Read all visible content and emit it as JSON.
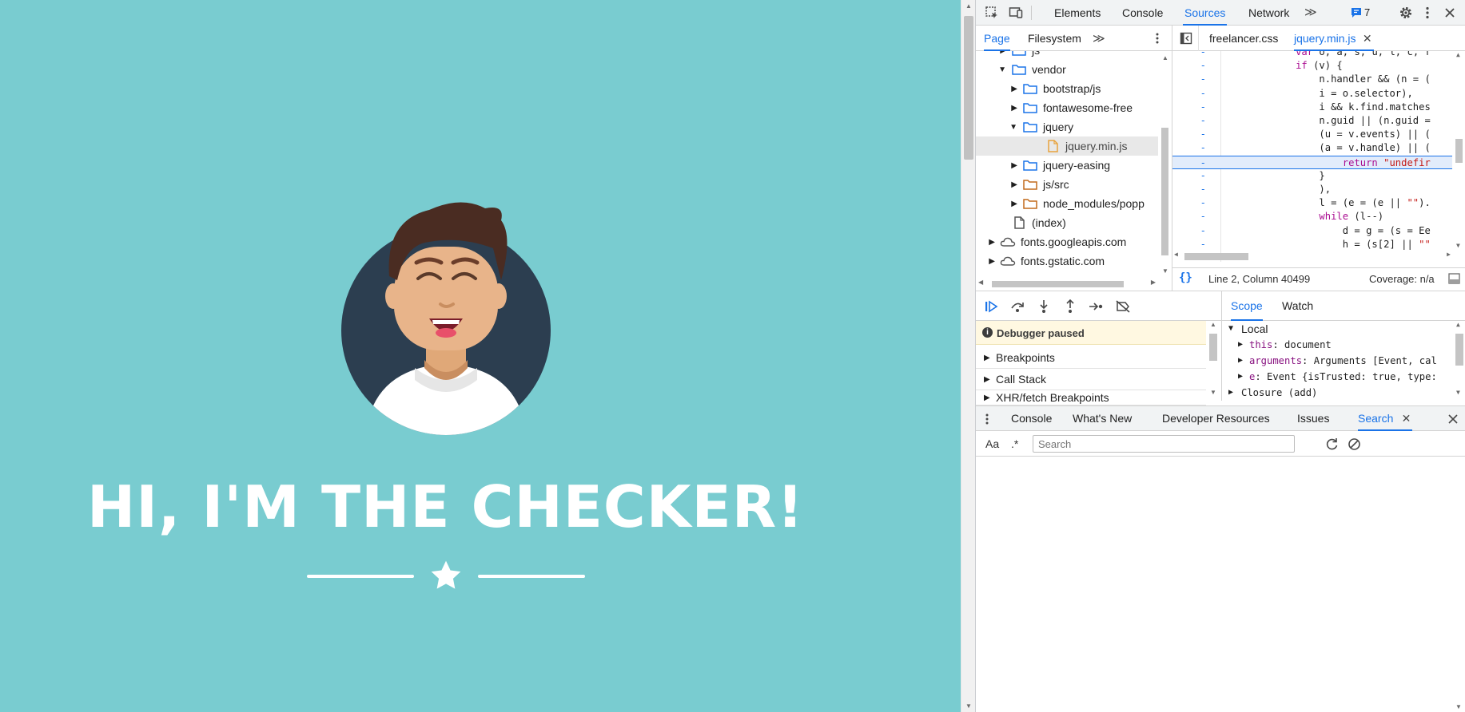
{
  "page": {
    "hero_title": "HI, I'M THE CHECKER!",
    "colors": {
      "background": "#79ccd0",
      "avatar_bg": "#2c3e50",
      "text": "#ffffff"
    }
  },
  "devtools": {
    "main_tabs": [
      "Elements",
      "Console",
      "Sources",
      "Network"
    ],
    "active_main_tab": "Sources",
    "issues_count": "7",
    "navigator_tabs": [
      "Page",
      "Filesystem"
    ],
    "tree": [
      {
        "label": "js",
        "kind": "folder",
        "color": "#1a73e8"
      },
      {
        "label": "vendor",
        "kind": "folder",
        "color": "#1a73e8"
      },
      {
        "label": "bootstrap/js",
        "kind": "folder",
        "color": "#1a73e8"
      },
      {
        "label": "fontawesome-free",
        "kind": "folder",
        "color": "#1a73e8"
      },
      {
        "label": "jquery",
        "kind": "folder",
        "color": "#1a73e8"
      },
      {
        "label": "jquery.min.js",
        "kind": "file",
        "color": "#e8a33d"
      },
      {
        "label": "jquery-easing",
        "kind": "folder",
        "color": "#1a73e8"
      },
      {
        "label": "js/src",
        "kind": "folder",
        "color": "#c26a1b"
      },
      {
        "label": "node_modules/popp",
        "kind": "folder",
        "color": "#c26a1b"
      },
      {
        "label": "(index)",
        "kind": "file",
        "color": "#555555"
      },
      {
        "label": "fonts.googleapis.com",
        "kind": "cloud",
        "color": "#555555"
      },
      {
        "label": "fonts.gstatic.com",
        "kind": "cloud",
        "color": "#555555"
      }
    ],
    "file_tabs": [
      "freelancer.css",
      "jquery.min.js"
    ],
    "active_file_tab": "jquery.min.js",
    "code_lines": [
      {
        "gutter": "-",
        "text": "            var o, a, s, u, l, c, f"
      },
      {
        "gutter": "-",
        "text": "            if (v) {"
      },
      {
        "gutter": "-",
        "text": "                n.handler && (n = ("
      },
      {
        "gutter": "-",
        "text": "                i = o.selector),"
      },
      {
        "gutter": "-",
        "text": "                i && k.find.matches"
      },
      {
        "gutter": "-",
        "text": "                n.guid || (n.guid ="
      },
      {
        "gutter": "-",
        "text": "                (u = v.events) || ("
      },
      {
        "gutter": "-",
        "text": "                (a = v.handle) || ("
      },
      {
        "gutter": "-",
        "text": "                    return \"undefir"
      },
      {
        "gutter": "-",
        "text": "                }"
      },
      {
        "gutter": "-",
        "text": "                ),"
      },
      {
        "gutter": "-",
        "text": "                l = (e = (e || \"\")."
      },
      {
        "gutter": "-",
        "text": "                while (l--)"
      },
      {
        "gutter": "-",
        "text": "                    d = g = (s = Ee"
      },
      {
        "gutter": "-",
        "text": "                    h = (s[2] || \"\""
      }
    ],
    "status": {
      "position": "Line 2, Column 40499",
      "coverage": "Coverage: n/a"
    },
    "debugger_paused": "Debugger paused",
    "sections": [
      "Breakpoints",
      "Call Stack",
      "XHR/fetch Breakpoints"
    ],
    "scope_tabs": [
      "Scope",
      "Watch"
    ],
    "scope": {
      "local_label": "Local",
      "rows": [
        {
          "key": "this",
          "value": "document"
        },
        {
          "key": "arguments",
          "value": "Arguments [Event, cal"
        },
        {
          "key": "e",
          "value": "Event {isTrusted: true, type:"
        }
      ],
      "closure_label": "Closure (add)"
    },
    "drawer_tabs": [
      "Console",
      "What's New",
      "Developer Resources",
      "Issues",
      "Search"
    ],
    "active_drawer_tab": "Search",
    "search": {
      "case_label": "Aa",
      "regex_label": ".*",
      "placeholder": "Search"
    }
  }
}
